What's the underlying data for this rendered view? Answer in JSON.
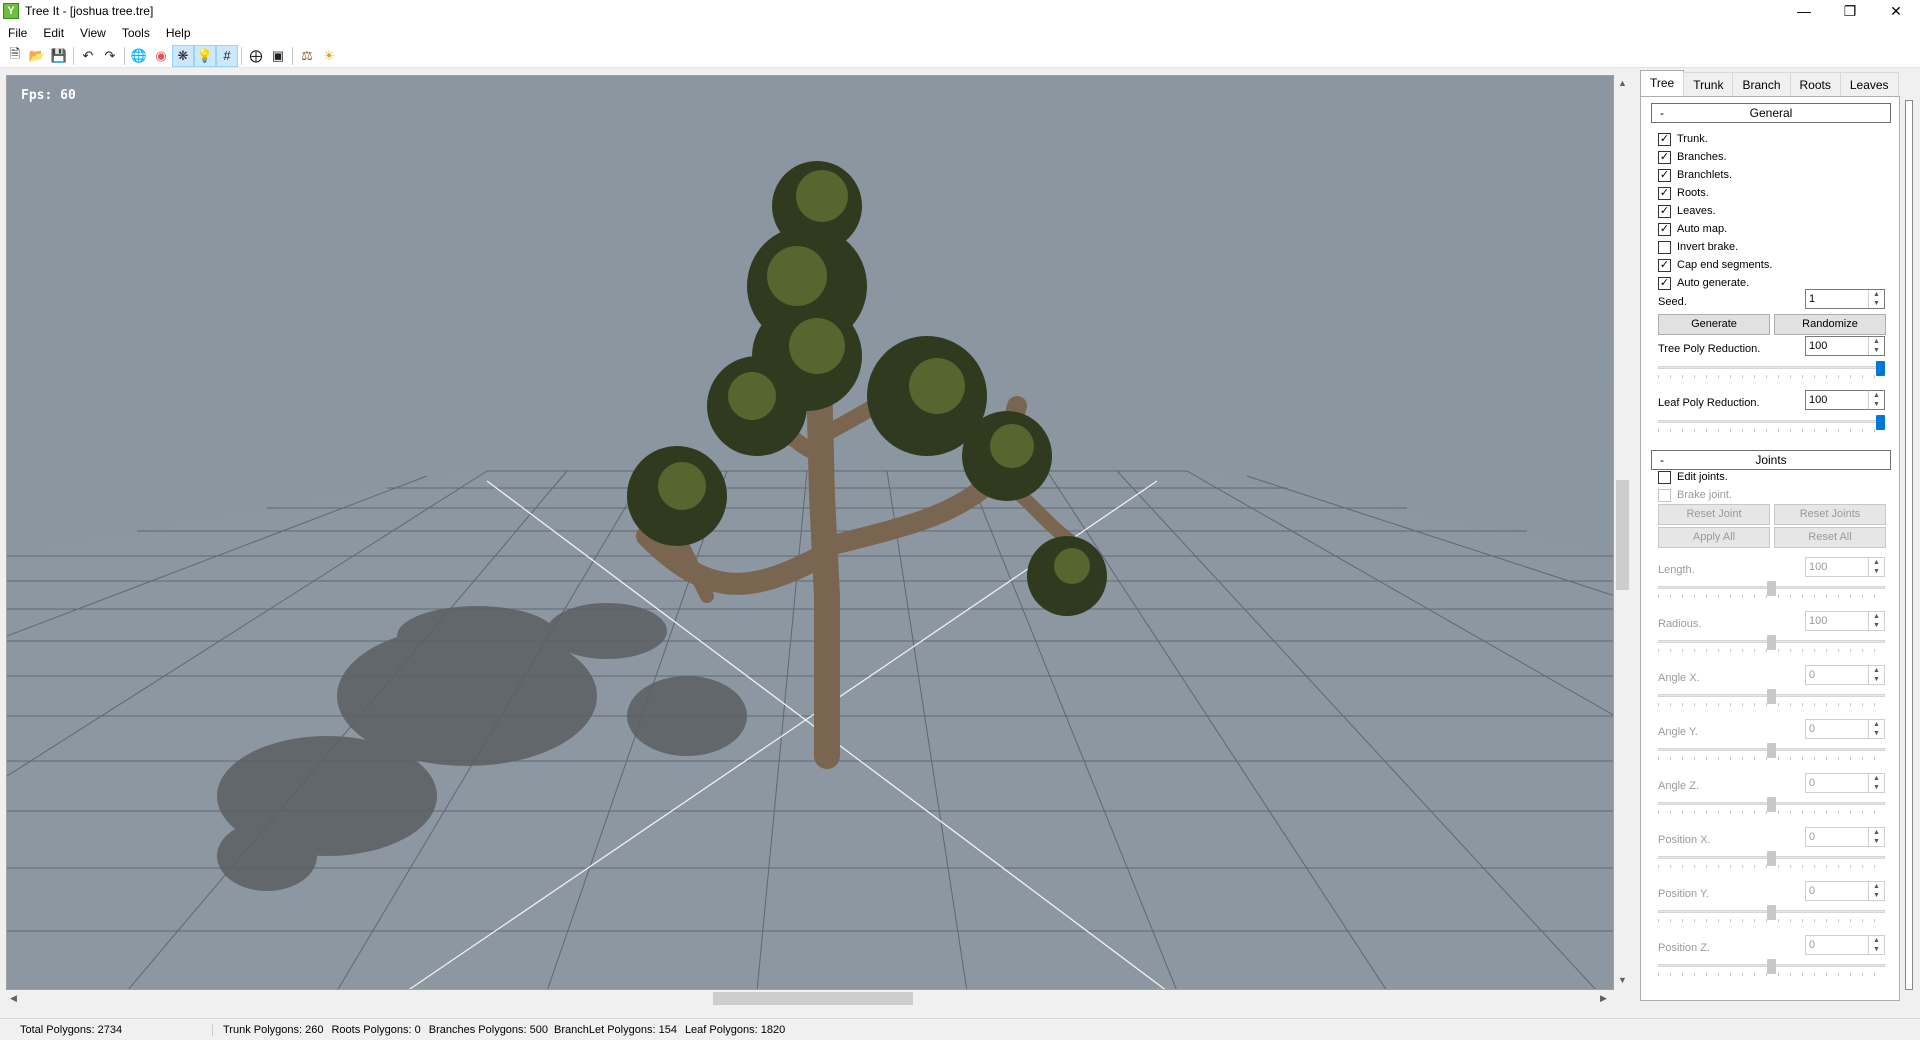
{
  "window": {
    "title": "Tree It - [joshua tree.tre]"
  },
  "menu": [
    "File",
    "Edit",
    "View",
    "Tools",
    "Help"
  ],
  "toolbar": {
    "icons": [
      "new-file-icon",
      "open-file-icon",
      "save-icon",
      "undo-icon",
      "redo-icon",
      "wireframe-icon",
      "color-icon",
      "texture-icon",
      "light-icon",
      "grid-icon",
      "center-icon",
      "fit-view-icon",
      "tree-icon",
      "sun-icon"
    ]
  },
  "viewport": {
    "fps_label": "Fps: 60",
    "background": "#8a95a0"
  },
  "tabs": [
    "Tree",
    "Trunk",
    "Branch",
    "Roots",
    "Leaves"
  ],
  "general": {
    "header": "General",
    "collapse": "-",
    "checkboxes": [
      {
        "label": "Trunk.",
        "checked": true
      },
      {
        "label": "Branches.",
        "checked": true
      },
      {
        "label": "Branchlets.",
        "checked": true
      },
      {
        "label": "Roots.",
        "checked": true
      },
      {
        "label": "Leaves.",
        "checked": true
      },
      {
        "label": "Auto map.",
        "checked": true
      },
      {
        "label": "Invert brake.",
        "checked": false
      },
      {
        "label": "Cap end segments.",
        "checked": true
      },
      {
        "label": "Auto generate.",
        "checked": true
      }
    ],
    "seed_label": "Seed.",
    "seed_value": "1",
    "generate_label": "Generate",
    "randomize_label": "Randomize",
    "tree_poly_label": "Tree Poly Reduction.",
    "tree_poly_value": "100",
    "tree_poly_level": 1.0,
    "leaf_poly_label": "Leaf Poly Reduction.",
    "leaf_poly_value": "100",
    "leaf_poly_level": 1.0
  },
  "joints": {
    "header": "Joints",
    "collapse": "-",
    "edit_joints": "Edit joints.",
    "brake_joint": "Brake joint.",
    "reset_joint": "Reset Joint",
    "reset_joints": "Reset Joints",
    "apply_all": "Apply All",
    "reset_all": "Reset All",
    "params": [
      {
        "label": "Length.",
        "value": "100",
        "level": 0.5
      },
      {
        "label": "Radious.",
        "value": "100",
        "level": 0.5
      },
      {
        "label": "Angle X.",
        "value": "0",
        "level": 0.5
      },
      {
        "label": "Angle Y.",
        "value": "0",
        "level": 0.5
      },
      {
        "label": "Angle Z.",
        "value": "0",
        "level": 0.5
      },
      {
        "label": "Position X.",
        "value": "0",
        "level": 0.5
      },
      {
        "label": "Position Y.",
        "value": "0",
        "level": 0.5
      },
      {
        "label": "Position Z.",
        "value": "0",
        "level": 0.5
      }
    ]
  },
  "status": {
    "total": "Total Polygons: 2734",
    "trunk": "Trunk Polygons: 260",
    "roots": "Roots Polygons: 0",
    "branches": "Branches Polygons: 500",
    "branchlet": "BranchLet Polygons: 154",
    "leaf": "Leaf Polygons:  1820"
  }
}
